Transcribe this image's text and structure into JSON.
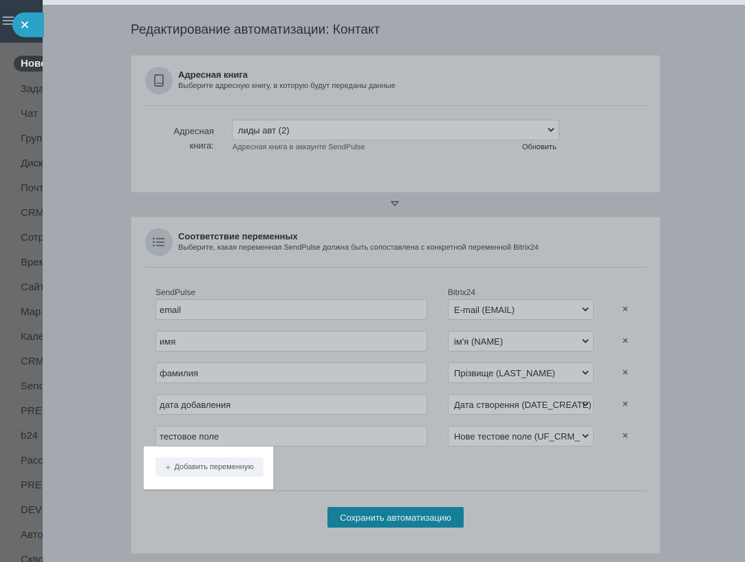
{
  "sidebar": {
    "items": [
      {
        "label": "Ново",
        "active": true
      },
      {
        "label": "Зада"
      },
      {
        "label": "Чат"
      },
      {
        "label": "Груп"
      },
      {
        "label": "Диск"
      },
      {
        "label": "Почт"
      },
      {
        "label": "CRM"
      },
      {
        "label": "Сотр"
      },
      {
        "label": "Врем"
      },
      {
        "label": "Сайт"
      },
      {
        "label": "Мар"
      },
      {
        "label": "Кале"
      },
      {
        "label": "CRM"
      },
      {
        "label": "Send"
      },
      {
        "label": "PRE"
      },
      {
        "label": "b24"
      },
      {
        "label": "Расс"
      },
      {
        "label": "PRE"
      },
      {
        "label": "DEV"
      },
      {
        "label": "Авто"
      },
      {
        "label": "Скво"
      }
    ]
  },
  "page": {
    "title": "Редактирование автоматизации: Контакт"
  },
  "address_book": {
    "title": "Адресная книга",
    "subtitle": "Выберите адресную книгу, в которую будут переданы данные",
    "field_label": "Адресная книга:",
    "selected": "лиды авт (2)",
    "hint": "Адресная книга в аккаунте SendPulse",
    "refresh_label": "Обновить"
  },
  "mapping": {
    "title": "Соответствие переменных",
    "subtitle": "Выберите, какая переменная SendPulse должна быть сопоставлена с конкретной переменной Bitrix24",
    "col_sendpulse": "SendPulse",
    "col_bitrix": "Bitrix24",
    "rows": [
      {
        "sendpulse": "email",
        "bitrix": "E-mail (EMAIL)"
      },
      {
        "sendpulse": "имя",
        "bitrix": "ім'я (NAME)"
      },
      {
        "sendpulse": "фамилия",
        "bitrix": "Прізвище (LAST_NAME)"
      },
      {
        "sendpulse": "дата добавления",
        "bitrix": "Дата створення (DATE_CREATE)"
      },
      {
        "sendpulse": "тестовое поле",
        "bitrix": "Нове тестове поле (UF_CRM_"
      }
    ],
    "add_label": "Добавить переменную",
    "save_label": "Сохранить автоматизацию"
  }
}
